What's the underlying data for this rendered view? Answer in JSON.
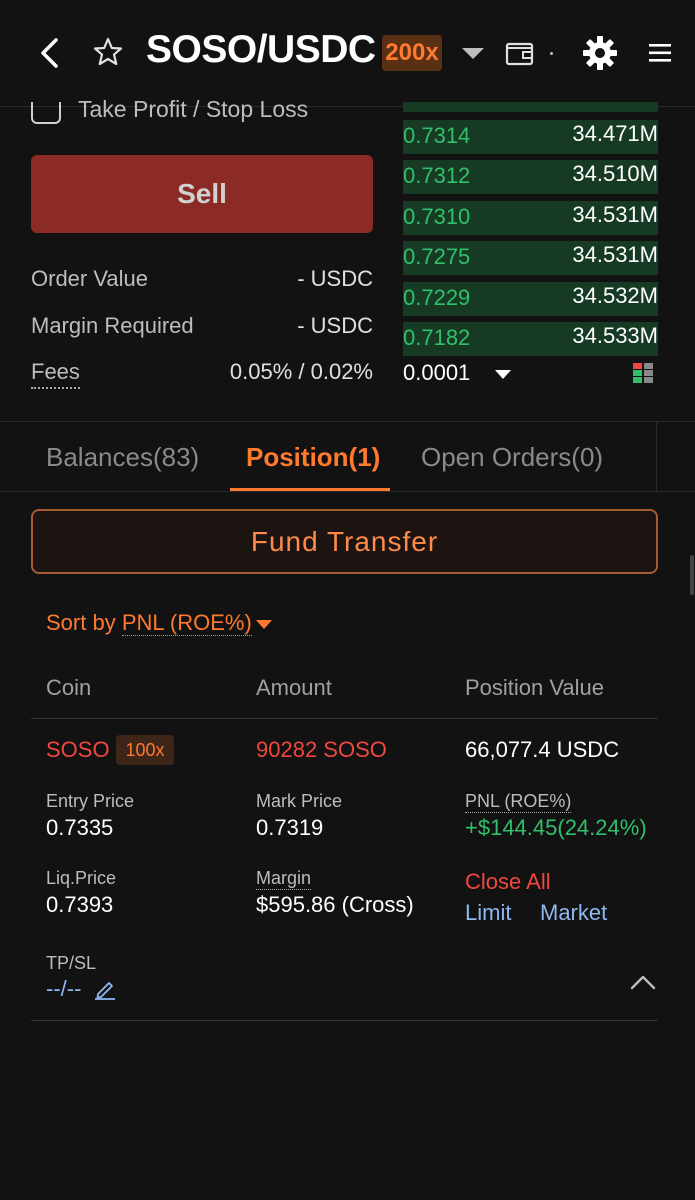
{
  "header": {
    "pair": "SOSO/USDC",
    "leverage": "200x"
  },
  "order_form": {
    "tpsl_label": "Take Profit / Stop Loss",
    "sell_label": "Sell",
    "order_value_label": "Order Value",
    "order_value": "- USDC",
    "margin_required_label": "Margin Required",
    "margin_required": "- USDC",
    "fees_label": "Fees",
    "fees_value": "0.05% / 0.02%"
  },
  "order_book": {
    "rows": [
      {
        "price": "0.7314",
        "size": "34.471M"
      },
      {
        "price": "0.7312",
        "size": "34.510M"
      },
      {
        "price": "0.7310",
        "size": "34.531M"
      },
      {
        "price": "0.7275",
        "size": "34.531M"
      },
      {
        "price": "0.7229",
        "size": "34.532M"
      },
      {
        "price": "0.7182",
        "size": "34.533M"
      }
    ],
    "tick_size": "0.0001"
  },
  "tabs": [
    {
      "label": "Balances(83)"
    },
    {
      "label": "Position(1)"
    },
    {
      "label": "Open Orders(0)"
    }
  ],
  "fund_transfer_label": "Fund Transfer",
  "sort": {
    "prefix": "Sort by",
    "field": "PNL (ROE%)"
  },
  "columns": {
    "coin": "Coin",
    "amount": "Amount",
    "position_value": "Position Value"
  },
  "position": {
    "coin": "SOSO",
    "leverage": "100x",
    "amount": "90282 SOSO",
    "position_value": "66,077.4 USDC",
    "entry_price_label": "Entry Price",
    "entry_price": "0.7335",
    "mark_price_label": "Mark Price",
    "mark_price": "0.7319",
    "pnl_label": "PNL (ROE%)",
    "pnl": "+$144.45(24.24%)",
    "liq_price_label": "Liq.Price",
    "liq_price": "0.7393",
    "margin_label": "Margin",
    "margin": "$595.86 (Cross)",
    "close_all_label": "Close All",
    "limit_label": "Limit",
    "market_label": "Market",
    "tpsl_label": "TP/SL",
    "tpsl_value": "--/--"
  },
  "colors": {
    "accent": "#ff7a2f",
    "sell": "#8c2a26",
    "bid_green": "#30c06a",
    "loss_red": "#f0483e"
  }
}
